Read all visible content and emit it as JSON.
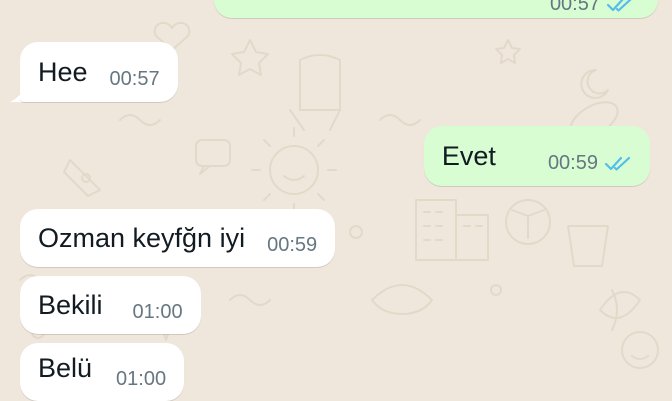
{
  "chat": {
    "messages": [
      {
        "direction": "outgoing",
        "text": "",
        "time": "00:57",
        "status": "read-ticks-icon"
      },
      {
        "direction": "incoming",
        "text": "Hee",
        "time": "00:57"
      },
      {
        "direction": "outgoing",
        "text": "Evet",
        "time": "00:59",
        "status": "read-ticks-icon"
      },
      {
        "direction": "incoming",
        "text": "Ozman keyfğn iyi",
        "time": "00:59"
      },
      {
        "direction": "incoming",
        "text": "Bekili",
        "time": "01:00"
      },
      {
        "direction": "incoming",
        "text": "Belü",
        "time": "01:00"
      }
    ]
  },
  "colors": {
    "wallpaper": "#efe7dc",
    "incoming_bubble": "#ffffff",
    "outgoing_bubble": "#d9fdd3",
    "read_ticks": "#53bdeb",
    "time_text": "#667781"
  }
}
